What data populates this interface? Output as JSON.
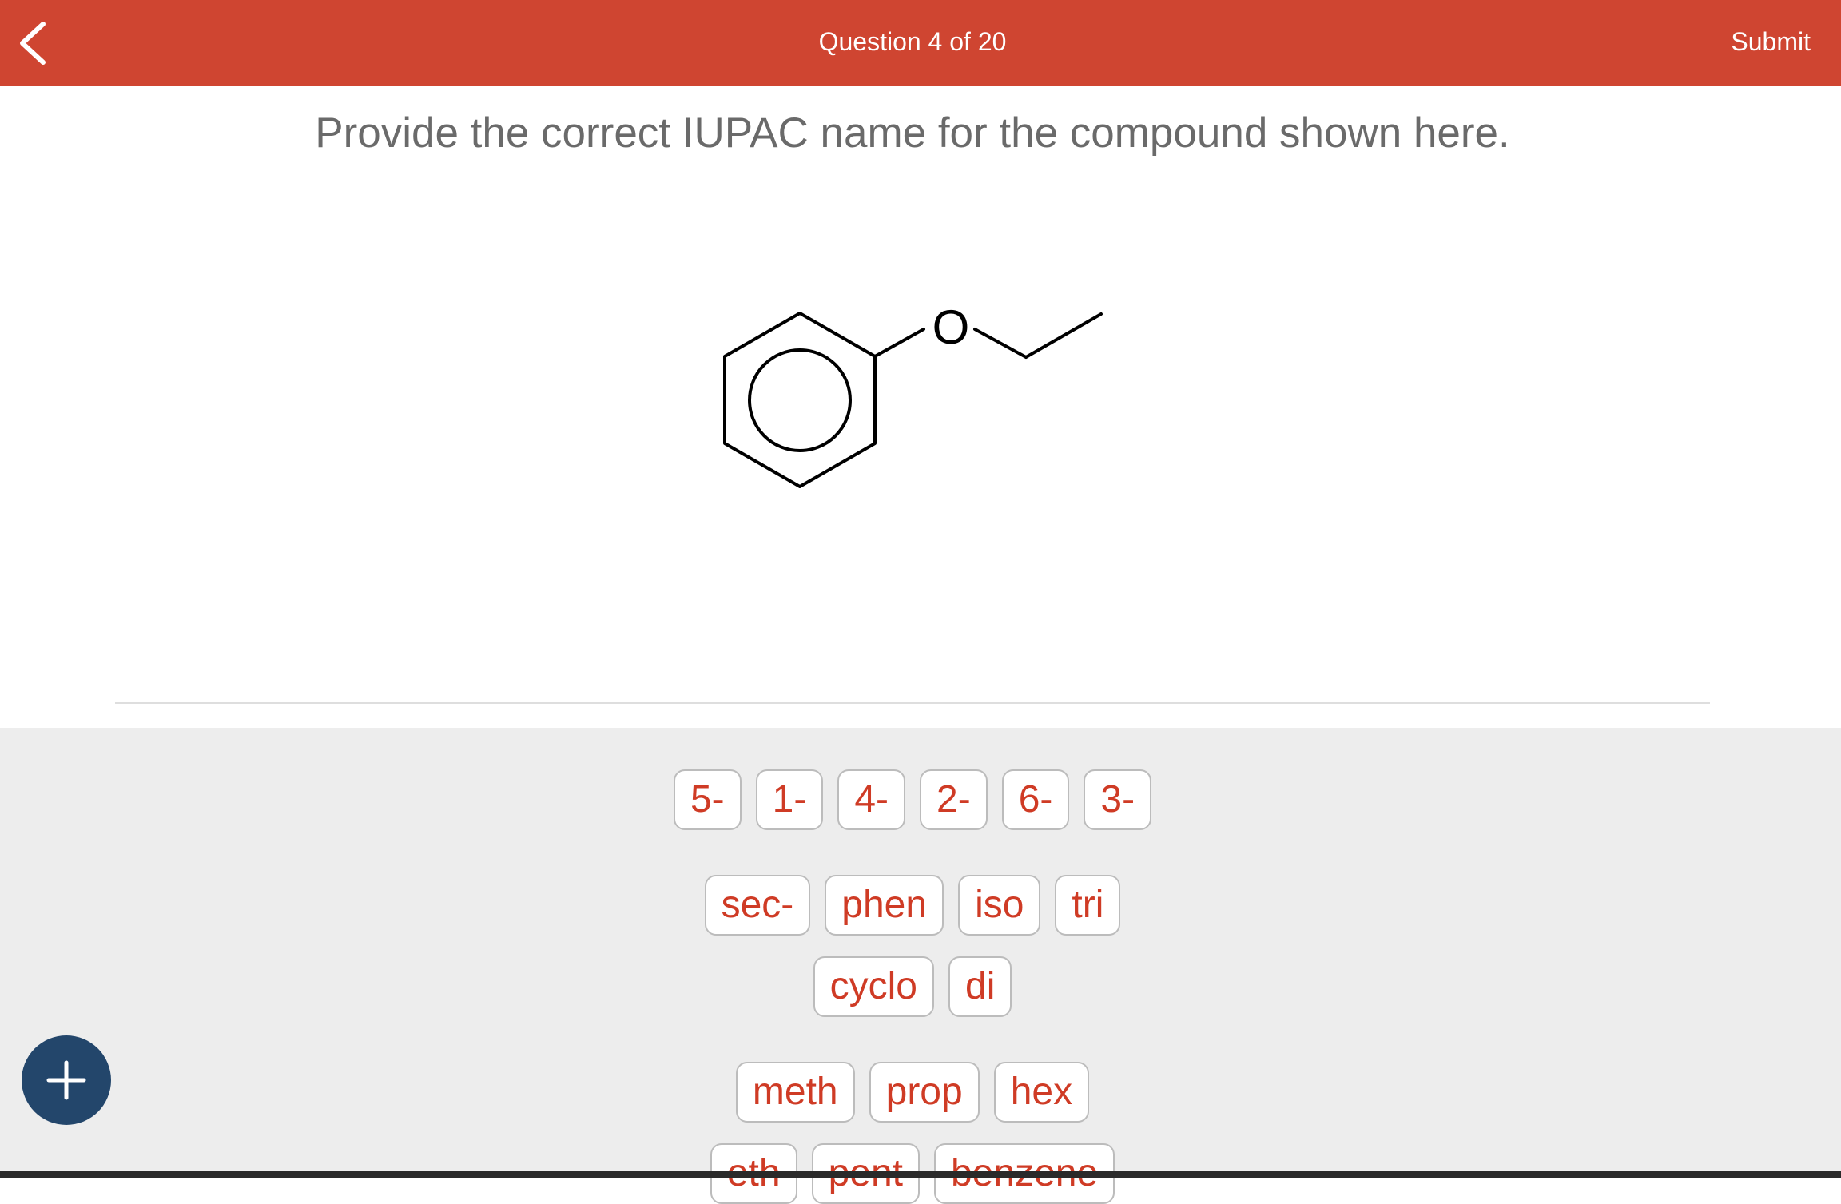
{
  "header": {
    "title": "Question 4 of 20",
    "submit_label": "Submit",
    "back_icon": "chevron-left-icon"
  },
  "question": {
    "prompt": "Provide the correct IUPAC name for the compound shown here.",
    "structure": {
      "oxygen_label": "O"
    }
  },
  "tray": {
    "locant_tiles": [
      "5-",
      "1-",
      "4-",
      "2-",
      "6-",
      "3-"
    ],
    "prefix_tiles": [
      "sec-",
      "phen",
      "iso",
      "tri"
    ],
    "modifier_tiles": [
      "cyclo",
      "di"
    ],
    "parent_tiles": [
      "meth",
      "prop",
      "hex"
    ],
    "partial_tiles": [
      "eth",
      "pent",
      "benzene"
    ]
  },
  "fab": {
    "icon": "plus-icon"
  },
  "colors": {
    "header_bg": "#cf4531",
    "tile_text": "#cf3b25",
    "fab_bg": "#23466b",
    "tray_bg": "#ededed"
  }
}
